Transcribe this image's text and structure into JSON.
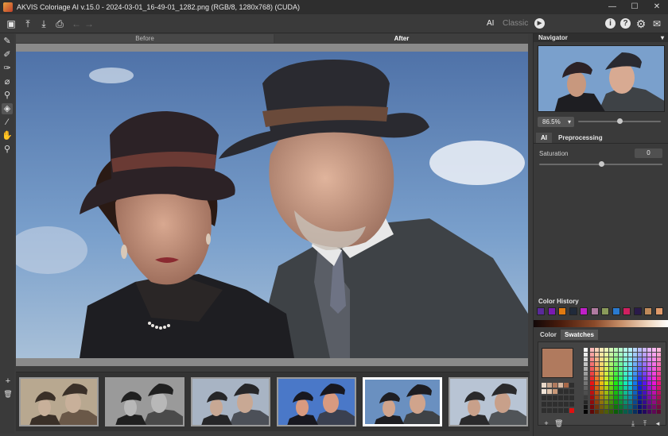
{
  "app": {
    "title": "AKVIS Coloriage AI v.15.0 - 2024-03-01_16-49-01_1282.png (RGB/8, 1280x768) (CUDA)",
    "window_buttons": {
      "minimize": "—",
      "maximize": "☐",
      "close": "✕"
    }
  },
  "toolbar": {
    "icons": [
      "image-icon",
      "open-icon",
      "save-icon",
      "print-icon",
      "undo-icon",
      "redo-icon"
    ],
    "mode_ai": "AI",
    "mode_classic": "Classic",
    "right_icons": [
      "run-icon",
      "info-icon",
      "help-icon",
      "settings-icon",
      "notifications-icon"
    ]
  },
  "tools": [
    "pencil-icon",
    "color-brush-icon",
    "keep-color-icon",
    "eraser-icon",
    "recolor-icon",
    "bucket-icon",
    "eyedropper-icon",
    "hand-icon",
    "zoom-icon"
  ],
  "view_tabs": {
    "before": "Before",
    "after": "After"
  },
  "filmstrip": {
    "thumbnails": [
      {
        "style": "sepia",
        "selected": false
      },
      {
        "style": "bw",
        "selected": false
      },
      {
        "style": "muted",
        "selected": false
      },
      {
        "style": "vivid",
        "selected": false
      },
      {
        "style": "natural",
        "selected": true
      },
      {
        "style": "soft",
        "selected": false
      }
    ],
    "add_icon": "+",
    "delete_icon": "trash-icon"
  },
  "panel": {
    "navigator_label": "Navigator",
    "zoom_value": "86.5%",
    "tab_ai": "AI",
    "tab_preprocessing": "Preprocessing",
    "saturation_label": "Saturation",
    "saturation_value": "0",
    "saturation_level": 0.5,
    "zoom_level": 0.5,
    "color_history_label": "Color History",
    "color_history": [
      "#5a2a9a",
      "#7a1ab0",
      "#e07a10",
      "#202a3a",
      "#c020c8",
      "#b07aa0",
      "#8a9a5a",
      "#2a7ad0",
      "#d02060",
      "#2a1a4a",
      "#c08a5a",
      "#e09a6a"
    ],
    "tab_color": "Color",
    "tab_swatches": "Swatches",
    "current_color": "#b07a5e"
  }
}
